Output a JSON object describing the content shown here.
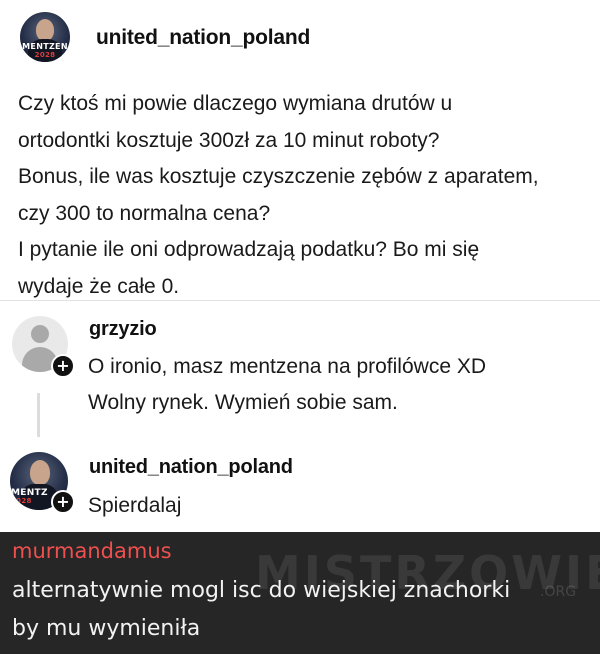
{
  "post": {
    "username": "united_nation_poland",
    "avatar_badge": "MENTZEN",
    "avatar_year": "2028",
    "lines": [
      "Czy ktoś mi powie dlaczego wymiana drutów u",
      "ortodontki kosztuje 300zł za 10 minut roboty?",
      "Bonus, ile was kosztuje czyszczenie zębów z aparatem,",
      "czy 300 to normalna cena?",
      "I pytanie ile oni odprowadzają podatku? Bo mi się",
      "wydaje że całe 0."
    ]
  },
  "replies": [
    {
      "username": "grzyzio",
      "avatar_icon": "default-user-icon",
      "lines": [
        "O ironio, masz mentzena na profilówce XD",
        "Wolny rynek. Wymień sobie sam."
      ]
    },
    {
      "username": "united_nation_poland",
      "avatar_badge": "MENTZ",
      "avatar_year": "2028",
      "lines": [
        "Spierdalaj"
      ]
    }
  ],
  "comment": {
    "username": "murmandamus",
    "lines": [
      "alternatywnie mogl isc do wiejskiej znachorki",
      "by mu wymieniła"
    ]
  },
  "watermark": {
    "text": "MISTRZOWIE",
    "suffix": ".ORG"
  },
  "colors": {
    "dark_panel": "#262626",
    "comment_username": "#ee4f4f",
    "avatar_year": "#e23b3b"
  }
}
